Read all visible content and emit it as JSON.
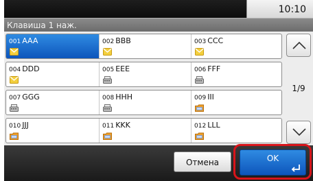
{
  "status_bar": {
    "time": "10:10"
  },
  "title": "Клавиша 1 наж.",
  "rows": [
    [
      {
        "number": "001",
        "name": "AAA",
        "icon": "email-icon",
        "selected": true
      },
      {
        "number": "002",
        "name": "BBB",
        "icon": "email-icon",
        "selected": false
      },
      {
        "number": "003",
        "name": "CCC",
        "icon": "email-icon",
        "selected": false
      }
    ],
    [
      {
        "number": "004",
        "name": "DDD",
        "icon": "email-icon",
        "selected": false
      },
      {
        "number": "005",
        "name": "EEE",
        "icon": "fax-icon",
        "selected": false
      },
      {
        "number": "006",
        "name": "FFF",
        "icon": "fax-icon",
        "selected": false
      }
    ],
    [
      {
        "number": "007",
        "name": "GGG",
        "icon": "fax-icon",
        "selected": false
      },
      {
        "number": "008",
        "name": "HHH",
        "icon": "fax-icon",
        "selected": false
      },
      {
        "number": "009",
        "name": "III",
        "icon": "folder-icon",
        "selected": false
      }
    ],
    [
      {
        "number": "010",
        "name": "JJJ",
        "icon": "folder-icon",
        "selected": false
      },
      {
        "number": "011",
        "name": "KKK",
        "icon": "folder-icon",
        "selected": false
      },
      {
        "number": "012",
        "name": "LLL",
        "icon": "folder-icon",
        "selected": false
      }
    ]
  ],
  "pager": {
    "indicator": "1/9",
    "up_icon": "chevron-up-icon",
    "down_icon": "chevron-down-icon"
  },
  "footer": {
    "cancel_label": "Отмена",
    "ok_label": "OK",
    "enter_icon": "enter-icon"
  },
  "colors": {
    "selection_blue": "#1e6fd0",
    "highlight_red": "#d8141a"
  }
}
